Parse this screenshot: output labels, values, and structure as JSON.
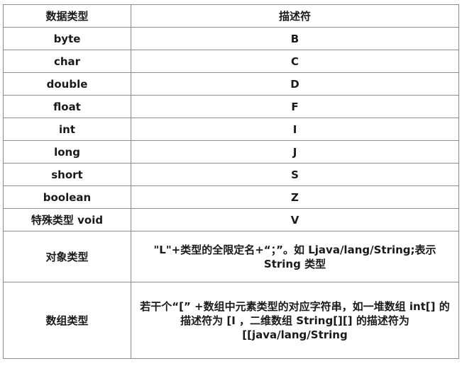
{
  "table": {
    "headers": [
      "数据类型",
      "描述符"
    ],
    "rows": [
      {
        "type": "byte",
        "descriptor": "B"
      },
      {
        "type": "char",
        "descriptor": "C"
      },
      {
        "type": "double",
        "descriptor": "D"
      },
      {
        "type": "float",
        "descriptor": "F"
      },
      {
        "type": "int",
        "descriptor": "I"
      },
      {
        "type": "long",
        "descriptor": "J"
      },
      {
        "type": "short",
        "descriptor": "S"
      },
      {
        "type": "boolean",
        "descriptor": "Z"
      },
      {
        "type": "特殊类型 void",
        "descriptor": "V"
      },
      {
        "type": "对象类型",
        "descriptor": "\"L\"+类型的全限定名+“；”。如 Ljava/lang/String;表示 String 类型"
      },
      {
        "type": "数组类型",
        "descriptor": "若干个“[” +数组中元素类型的对应字符串，如一堆数组 int[] 的描述符为 [I ，二维数组 String[][] 的描述符为 [[java/lang/String"
      }
    ]
  }
}
